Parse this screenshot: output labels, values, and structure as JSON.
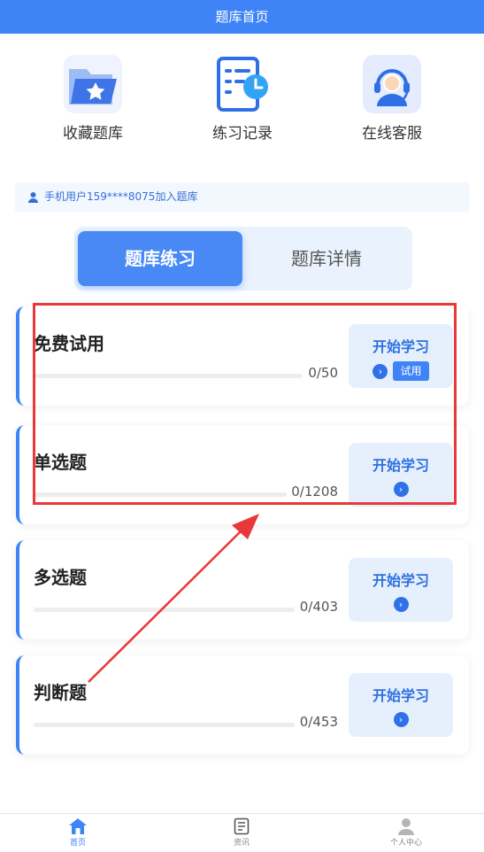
{
  "header": {
    "title": "题库首页"
  },
  "shortcuts": [
    {
      "label": "收藏题库",
      "icon": "folder-star-icon"
    },
    {
      "label": "练习记录",
      "icon": "record-clock-icon"
    },
    {
      "label": "在线客服",
      "icon": "customer-service-icon"
    }
  ],
  "notice": {
    "text": "手机用户159****8075加入题库",
    "icon": "user-icon"
  },
  "tabs": [
    {
      "label": "题库练习",
      "active": true
    },
    {
      "label": "题库详情",
      "active": false
    }
  ],
  "cards": [
    {
      "title": "免费试用",
      "done": 0,
      "total": 50,
      "count": "0/50",
      "button": "开始学习",
      "badge": "试用"
    },
    {
      "title": "单选题",
      "done": 0,
      "total": 1208,
      "count": "0/1208",
      "button": "开始学习"
    },
    {
      "title": "多选题",
      "done": 0,
      "total": 403,
      "count": "0/403",
      "button": "开始学习"
    },
    {
      "title": "判断题",
      "done": 0,
      "total": 453,
      "count": "0/453",
      "button": "开始学习"
    }
  ],
  "bottom_nav": [
    {
      "label": "首页",
      "icon": "home-icon",
      "active": true
    },
    {
      "label": "资讯",
      "icon": "news-icon",
      "active": false
    },
    {
      "label": "个人中心",
      "icon": "profile-icon",
      "active": false
    }
  ],
  "colors": {
    "primary": "#3f84f6",
    "annotation": "#e8383a"
  }
}
